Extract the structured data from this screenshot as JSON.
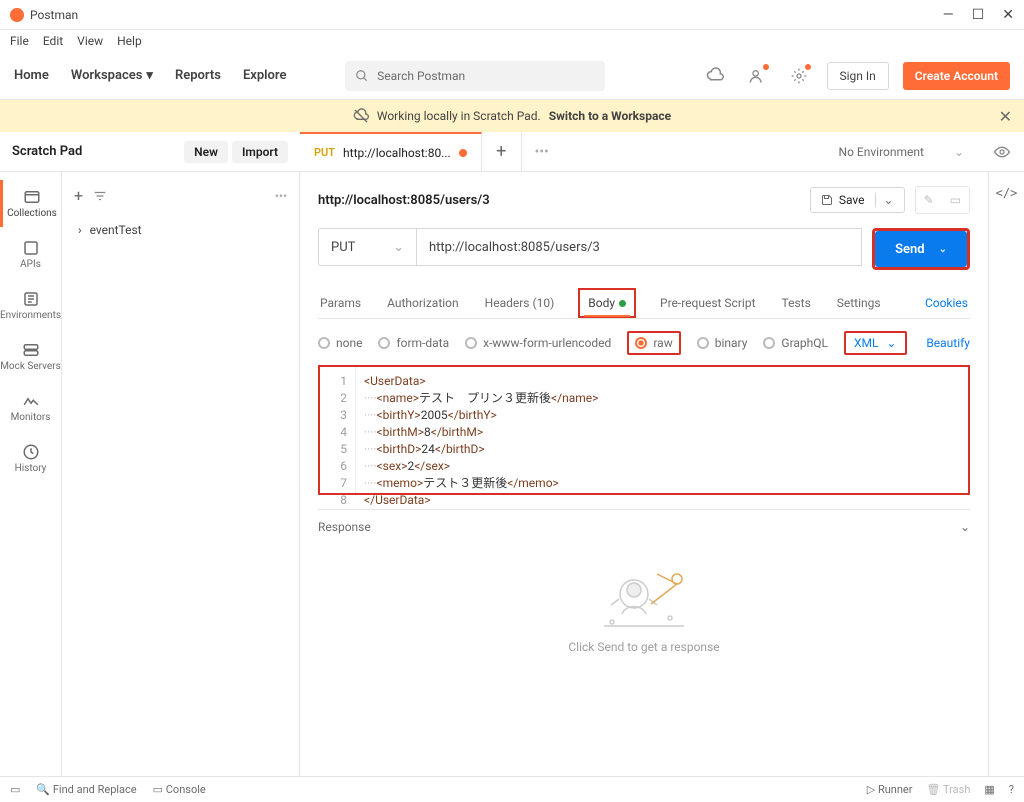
{
  "app": {
    "title": "Postman"
  },
  "menu": [
    "File",
    "Edit",
    "View",
    "Help"
  ],
  "nav": {
    "home": "Home",
    "workspaces": "Workspaces",
    "reports": "Reports",
    "explore": "Explore"
  },
  "search": {
    "placeholder": "Search Postman"
  },
  "auth": {
    "signin": "Sign In",
    "create": "Create Account"
  },
  "banner": {
    "text": "Working locally in Scratch Pad.",
    "link": "Switch to a Workspace"
  },
  "scratchpad": {
    "title": "Scratch Pad",
    "new": "New",
    "import": "Import"
  },
  "tab": {
    "method": "PUT",
    "label": "http://localhost:80..."
  },
  "env": "No Environment",
  "iconcol": [
    {
      "label": "Collections",
      "name": "collections"
    },
    {
      "label": "APIs",
      "name": "apis"
    },
    {
      "label": "Environments",
      "name": "environments"
    },
    {
      "label": "Mock Servers",
      "name": "mock-servers"
    },
    {
      "label": "Monitors",
      "name": "monitors"
    },
    {
      "label": "History",
      "name": "history"
    }
  ],
  "tree": {
    "item": "eventTest"
  },
  "request": {
    "title": "http://localhost:8085/users/3",
    "save": "Save",
    "method": "PUT",
    "url": "http://localhost:8085/users/3",
    "send": "Send"
  },
  "reqtabs": {
    "params": "Params",
    "auth": "Authorization",
    "headers": "Headers (10)",
    "body": "Body",
    "prereq": "Pre-request Script",
    "tests": "Tests",
    "settings": "Settings",
    "cookies": "Cookies"
  },
  "bodytypes": {
    "none": "none",
    "formdata": "form-data",
    "xwww": "x-www-form-urlencoded",
    "raw": "raw",
    "binary": "binary",
    "graphql": "GraphQL",
    "format": "XML",
    "beautify": "Beautify"
  },
  "code": {
    "lines": [
      "1",
      "2",
      "3",
      "4",
      "5",
      "6",
      "7",
      "8"
    ],
    "xml": {
      "root": "UserData",
      "name_tag": "name",
      "name_val": "テスト　プリン３更新後",
      "birthY_tag": "birthY",
      "birthY_val": "2005",
      "birthM_tag": "birthM",
      "birthM_val": "8",
      "birthD_tag": "birthD",
      "birthD_val": "24",
      "sex_tag": "sex",
      "sex_val": "2",
      "memo_tag": "memo",
      "memo_val": "テスト３更新後"
    }
  },
  "response": {
    "label": "Response",
    "hint": "Click Send to get a response"
  },
  "footer": {
    "find": "Find and Replace",
    "console": "Console",
    "runner": "Runner",
    "trash": "Trash"
  }
}
